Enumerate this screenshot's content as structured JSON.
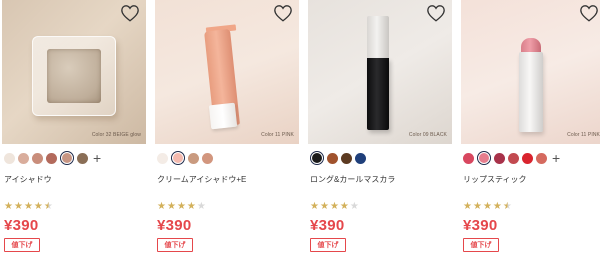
{
  "products": [
    {
      "name": "アイシャドウ",
      "color_caption": "Color 32 BEIGE glow",
      "price": "¥390",
      "badge": "値下げ",
      "rating": 4.5,
      "swatches": [
        "#efe5dc",
        "#d9ad9c",
        "#c98d7b",
        "#b36a5c",
        "#c79583",
        "#8a6e56"
      ],
      "selected_swatch": 4,
      "has_more": true,
      "more_symbol": "+"
    },
    {
      "name": "クリームアイシャドウ+E",
      "color_caption": "Color 11 PINK",
      "price": "¥390",
      "badge": "値下げ",
      "rating": 4,
      "swatches": [
        "#f4ece6",
        "#f3b9ae",
        "#c99a7f",
        "#d2967e"
      ],
      "selected_swatch": 1,
      "has_more": false,
      "more_symbol": ""
    },
    {
      "name": "ロング&カールマスカラ",
      "color_caption": "Color 09 BLACK",
      "price": "¥390",
      "badge": "値下げ",
      "rating": 4,
      "swatches": [
        "#1a1a1a",
        "#a0522d",
        "#5c3a21",
        "#1f3f7a"
      ],
      "selected_swatch": 0,
      "has_more": false,
      "more_symbol": ""
    },
    {
      "name": "リップスティック",
      "color_caption": "Color 11 PINK",
      "price": "¥390",
      "badge": "値下げ",
      "rating": 4.5,
      "swatches": [
        "#d8475f",
        "#e67d8d",
        "#a8324a",
        "#c24a50",
        "#d9242e",
        "#d56a5f"
      ],
      "selected_swatch": 1,
      "has_more": true,
      "more_symbol": "+"
    }
  ],
  "colors": {
    "price": "#e5474b",
    "star_on": "#d3b15b",
    "star_off": "#d9d9d9",
    "selected_ring": "#1e2a4a"
  },
  "icons": {
    "favorite": "heart-outline-icon",
    "more_colors": "plus-icon",
    "star": "star-icon"
  }
}
